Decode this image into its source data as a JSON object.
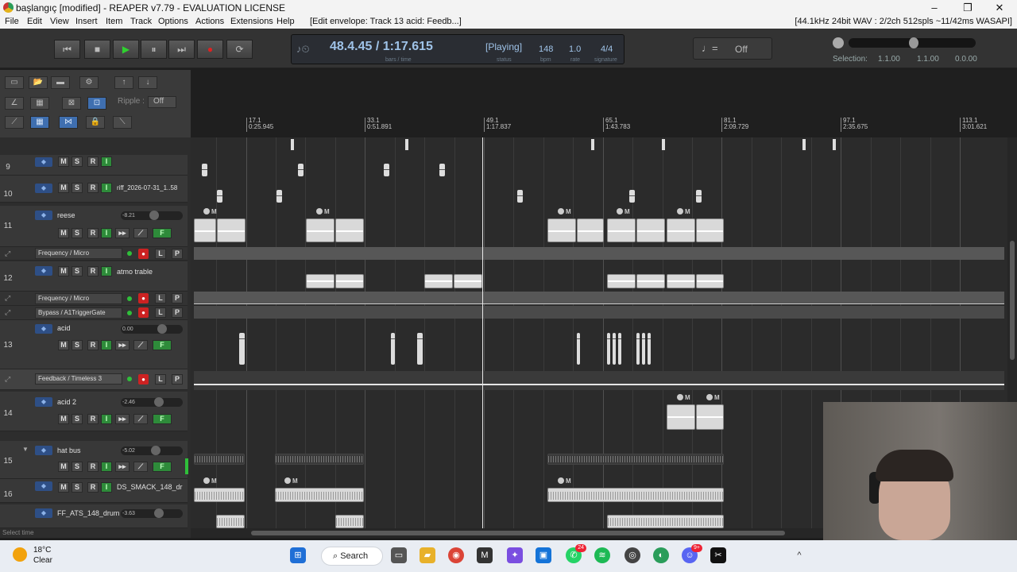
{
  "window": {
    "title": "başlangıç [modified] - REAPER v7.79 - EVALUATION LICENSE",
    "controls": [
      "–",
      "❐",
      "✕"
    ]
  },
  "menu": {
    "items": [
      "File",
      "Edit",
      "View",
      "Insert",
      "Item",
      "Track",
      "Options",
      "Actions",
      "Extensions",
      "Help"
    ],
    "context": "[Edit envelope: Track 13 acid: Feedb...]",
    "audio_status": "[44.1kHz 24bit WAV : 2/2ch 512spls ~11/42ms WASAPI]"
  },
  "transport": {
    "buttons": [
      "⏮",
      "■",
      "▶",
      "⏸",
      "⏭",
      "●",
      "⟳"
    ],
    "position": "48.4.45 / 1:17.615",
    "position_sub": "bars / time",
    "state": "[Playing]",
    "state_sub": "status",
    "bpm": "148",
    "bpm_sub": "bpm",
    "rate": "1.0",
    "rate_sub": "rate",
    "signature": "4/4",
    "signature_sub": "signature",
    "grid_label": "Off",
    "selection_label": "Selection:",
    "selection_start": "1.1.00",
    "selection_end": "1.1.00",
    "selection_length": "0.0.00"
  },
  "toolbar": {
    "ripple_label": "Ripple :",
    "ripple_value": "Off"
  },
  "ruler": {
    "marks": [
      {
        "bar": "17.1",
        "time": "0:25.945"
      },
      {
        "bar": "33.1",
        "time": "0:51.891"
      },
      {
        "bar": "49.1",
        "time": "1:17.837"
      },
      {
        "bar": "65.1",
        "time": "1:43.783"
      },
      {
        "bar": "81.1",
        "time": "2:09.729"
      },
      {
        "bar": "97.1",
        "time": "2:35.675"
      },
      {
        "bar": "113.1",
        "time": "3:01.621"
      }
    ]
  },
  "tracks": {
    "t9": {
      "num": "9",
      "name": ""
    },
    "t10": {
      "num": "10",
      "name": "riff_2026-07-31_1..58"
    },
    "t11": {
      "num": "11",
      "name": "reese",
      "vol": "-8.21"
    },
    "t11_env": "Frequency / Micro",
    "t12": {
      "num": "12",
      "name": "atmo trable"
    },
    "t12_env1": "Frequency / Micro",
    "t12_env2": "Bypass / A1TriggerGate",
    "t13": {
      "num": "13",
      "name": "acid",
      "vol": "0.00"
    },
    "t13_env": "Feedback / Timeless 3",
    "t14": {
      "num": "14",
      "name": "acid 2",
      "vol": "-2.46"
    },
    "t15": {
      "num": "15",
      "name": "hat bus",
      "vol": "-5.02"
    },
    "t16": {
      "num": "16",
      "name": "DS_SMACK_148_dr"
    },
    "t17": {
      "num": "",
      "name": "FF_ATS_148_drum",
      "vol": "-3.63"
    }
  },
  "buttons": {
    "m": "M",
    "s": "S",
    "r": "R",
    "io": "I",
    "fx": "F",
    "env_l": "L",
    "env_p": "P"
  },
  "statusbar": "Select time",
  "taskbar": {
    "temperature": "18°C",
    "condition": "Clear",
    "search": "Search",
    "whatsapp_badge": "24",
    "discord_badge": "9+"
  },
  "colors": {
    "play": "#2fd12f",
    "record": "#dd2222",
    "io_green": "#2e8b3a",
    "env_arm": "#cc2222",
    "track_icon": "#2e4f86"
  }
}
